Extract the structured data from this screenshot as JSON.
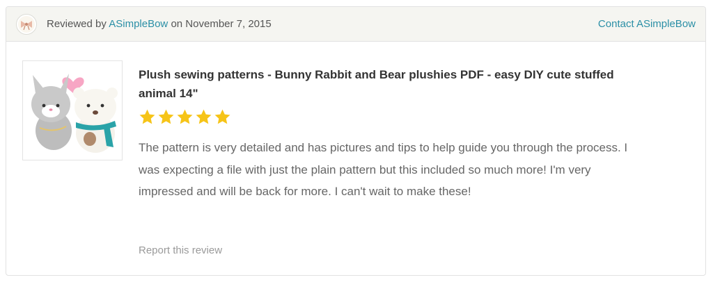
{
  "header": {
    "reviewed_prefix": "Reviewed by",
    "reviewer_name": "ASimpleBow",
    "date_text": "on November 7, 2015",
    "contact_label": "Contact ASimpleBow"
  },
  "review": {
    "product_title": "Plush sewing patterns - Bunny Rabbit and Bear plushies PDF - easy DIY cute stuffed animal 14\"",
    "rating": 5,
    "rating_max": 5,
    "text": "The pattern is very detailed and has pictures and tips to help guide you through the process. I was expecting a file with just the plain pattern but this included so much more! I'm very impressed and will be back for more. I can't wait to make these!",
    "report_label": "Report this review"
  },
  "colors": {
    "link": "#2b8fa6",
    "star": "#f6c418",
    "header_bg": "#f5f5f1"
  }
}
